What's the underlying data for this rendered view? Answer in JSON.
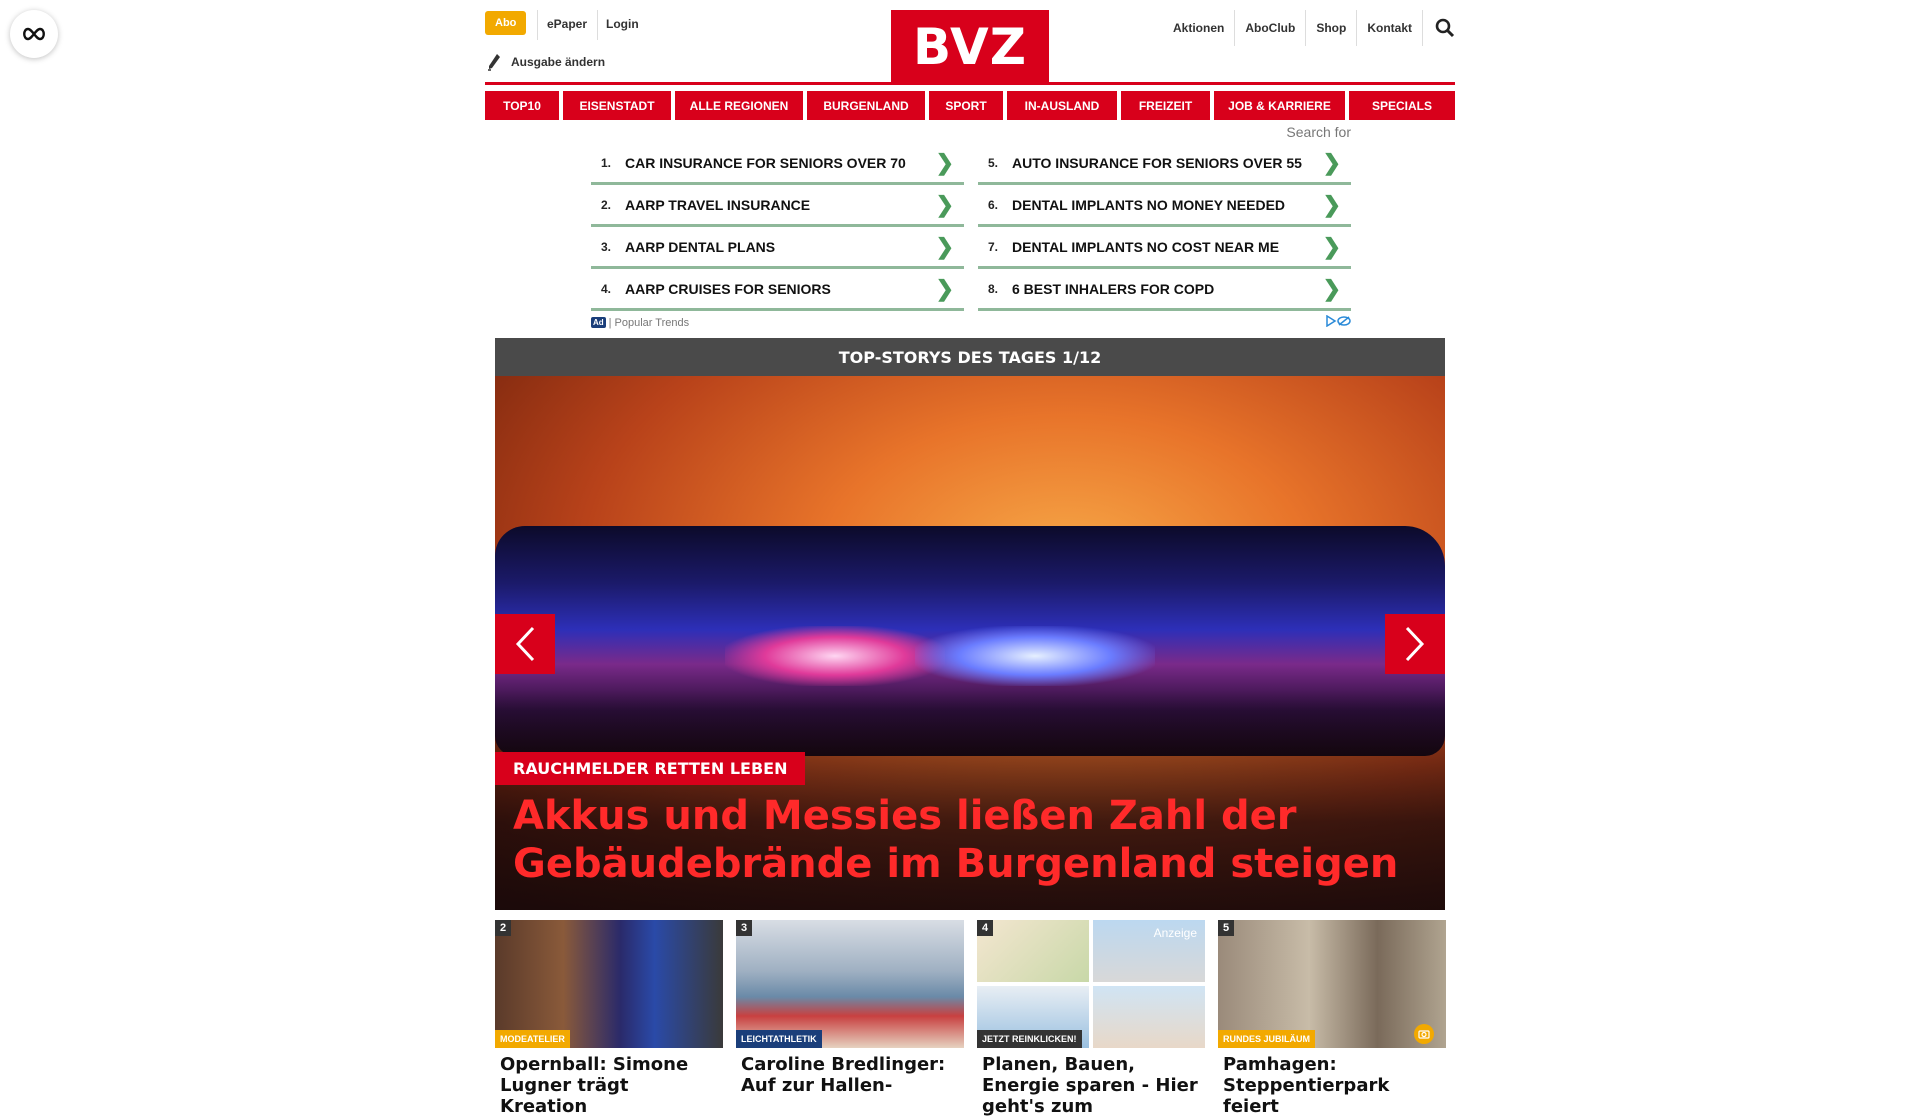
{
  "header": {
    "abo": "Abo",
    "epaper": "ePaper",
    "login": "Login",
    "ausgabe": "Ausgabe ändern",
    "logo": "BVZ",
    "right_links": [
      "Aktionen",
      "AboClub",
      "Shop",
      "Kontakt"
    ]
  },
  "nav": [
    "TOP10",
    "EISENSTADT",
    "ALLE REGIONEN",
    "BURGENLAND",
    "SPORT",
    "IN-AUSLAND",
    "FREIZEIT",
    "JOB & KARRIERE",
    "SPECIALS"
  ],
  "ads": {
    "search_for": "Search for",
    "left": [
      {
        "num": "1.",
        "text": "CAR INSURANCE FOR SENIORS OVER 70"
      },
      {
        "num": "2.",
        "text": "AARP TRAVEL INSURANCE"
      },
      {
        "num": "3.",
        "text": "AARP DENTAL PLANS"
      },
      {
        "num": "4.",
        "text": "AARP CRUISES FOR SENIORS"
      }
    ],
    "right": [
      {
        "num": "5.",
        "text": "AUTO INSURANCE FOR SENIORS OVER 55"
      },
      {
        "num": "6.",
        "text": "DENTAL IMPLANTS NO MONEY NEEDED"
      },
      {
        "num": "7.",
        "text": "DENTAL IMPLANTS NO COST NEAR ME"
      },
      {
        "num": "8.",
        "text": "6 BEST INHALERS FOR COPD"
      }
    ],
    "badge": "Ad",
    "footer": "Popular Trends"
  },
  "topstories": {
    "bar": "TOP-STORYS DES TAGES 1/12",
    "kicker": "RAUCHMELDER RETTEN LEBEN",
    "headline": "Akkus und Messies ließen Zahl der Gebäudebrände im Burgenland steigen"
  },
  "cards": [
    {
      "num": "2",
      "tag": "MODEATELIER",
      "tag_color": "#f2a900",
      "title": "Opernball: Simone Lugner trägt Kreation"
    },
    {
      "num": "3",
      "tag": "LEICHTATHLETIK",
      "tag_color": "#1a3e7a",
      "title": "Caroline Bredlinger: Auf zur Hallen-"
    },
    {
      "num": "4",
      "tag": "JETZT REINKLICKEN!",
      "tag_color": "#333333",
      "anzeige": "Anzeige",
      "title": "Planen, Bauen, Energie sparen - Hier geht's zum"
    },
    {
      "num": "5",
      "tag": "RUNDES JUBILÄUM",
      "tag_color": "#f2a900",
      "title": "Pamhagen: Steppentierpark feiert"
    }
  ],
  "colors": {
    "brand_red": "#d8001b",
    "abo_orange": "#f2a900",
    "ad_green": "#4a9a5a"
  }
}
